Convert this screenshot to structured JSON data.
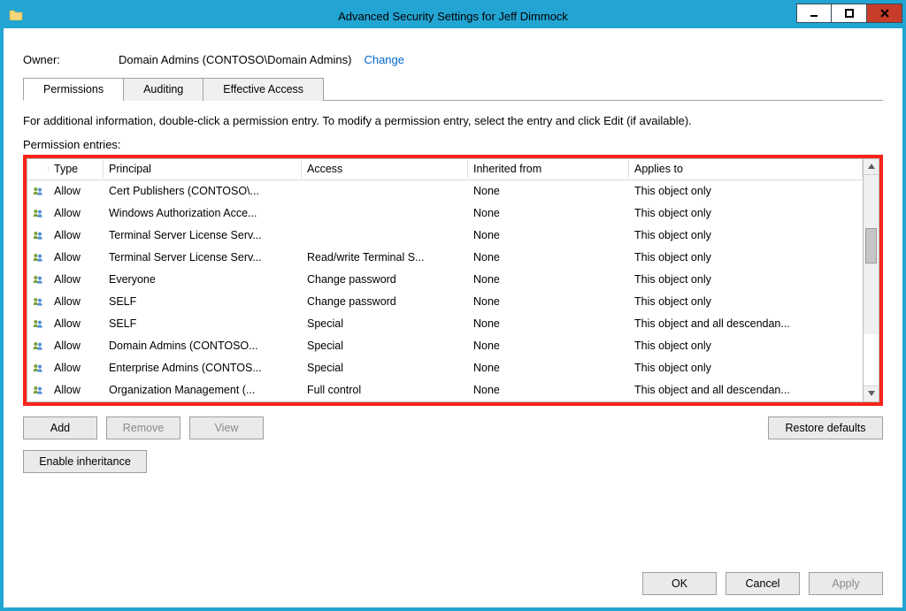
{
  "window": {
    "title": "Advanced Security Settings for Jeff Dimmock"
  },
  "owner": {
    "label": "Owner:",
    "value": "Domain Admins (CONTOSO\\Domain Admins)",
    "change": "Change"
  },
  "tabs": {
    "permissions": "Permissions",
    "auditing": "Auditing",
    "effective": "Effective Access"
  },
  "info": "For additional information, double-click a permission entry. To modify a permission entry, select the entry and click Edit (if available).",
  "entries_label": "Permission entries:",
  "columns": {
    "type": "Type",
    "principal": "Principal",
    "access": "Access",
    "inherited": "Inherited from",
    "applies": "Applies to"
  },
  "rows": [
    {
      "type": "Allow",
      "principal": "Cert Publishers (CONTOSO\\...",
      "access": "",
      "inherited": "None",
      "applies": "This object only"
    },
    {
      "type": "Allow",
      "principal": "Windows Authorization Acce...",
      "access": "",
      "inherited": "None",
      "applies": "This object only"
    },
    {
      "type": "Allow",
      "principal": "Terminal Server License Serv...",
      "access": "",
      "inherited": "None",
      "applies": "This object only"
    },
    {
      "type": "Allow",
      "principal": "Terminal Server License Serv...",
      "access": "Read/write Terminal S...",
      "inherited": "None",
      "applies": "This object only"
    },
    {
      "type": "Allow",
      "principal": "Everyone",
      "access": "Change password",
      "inherited": "None",
      "applies": "This object only"
    },
    {
      "type": "Allow",
      "principal": "SELF",
      "access": "Change password",
      "inherited": "None",
      "applies": "This object only"
    },
    {
      "type": "Allow",
      "principal": "SELF",
      "access": "Special",
      "inherited": "None",
      "applies": "This object and all descendan..."
    },
    {
      "type": "Allow",
      "principal": "Domain Admins (CONTOSO...",
      "access": "Special",
      "inherited": "None",
      "applies": "This object only"
    },
    {
      "type": "Allow",
      "principal": "Enterprise Admins (CONTOS...",
      "access": "Special",
      "inherited": "None",
      "applies": "This object only"
    },
    {
      "type": "Allow",
      "principal": "Organization Management (...",
      "access": "Full control",
      "inherited": "None",
      "applies": "This object and all descendan..."
    }
  ],
  "buttons": {
    "add": "Add",
    "remove": "Remove",
    "view": "View",
    "restore": "Restore defaults",
    "enable": "Enable inheritance",
    "ok": "OK",
    "cancel": "Cancel",
    "apply": "Apply"
  }
}
